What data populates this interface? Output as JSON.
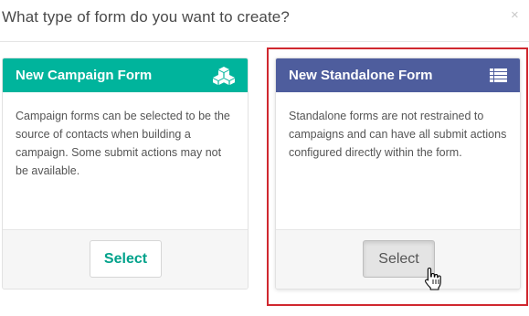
{
  "modal": {
    "title": "What type of form do you want to create?",
    "close_icon": "×"
  },
  "cards": {
    "campaign": {
      "title": "New Campaign Form",
      "icon": "cubes-icon",
      "description": "Campaign forms can be selected to be the source of contacts when building a campaign. Some submit actions may not be available.",
      "button_label": "Select",
      "header_color": "#00b49c"
    },
    "standalone": {
      "title": "New Standalone Form",
      "icon": "list-icon",
      "description": "Standalone forms are not restrained to campaigns and can have all submit actions configured directly within the form.",
      "button_label": "Select",
      "header_color": "#4e5d9d"
    }
  },
  "highlight_color": "#d0282f"
}
